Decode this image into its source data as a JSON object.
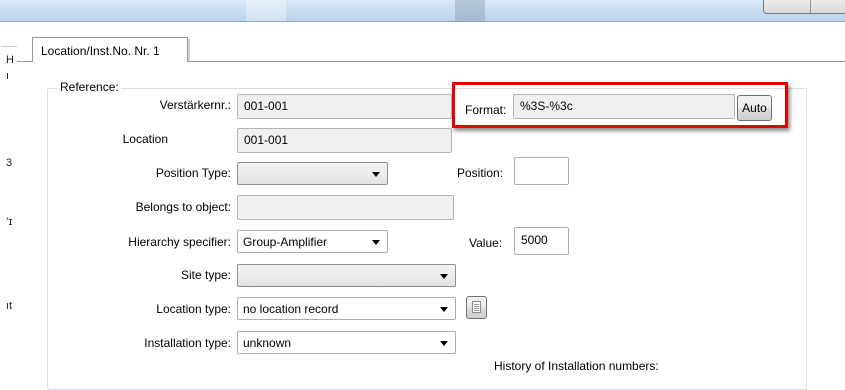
{
  "left_strip_glyphs": [
    "H",
    "ı",
    "3",
    "’ɪ",
    "ıt"
  ],
  "tab": {
    "label": "Location/Inst.No. Nr. 1"
  },
  "reference": {
    "legend": "Reference:",
    "verstarker": {
      "label": "Verstärkernr.:",
      "value": "001-001"
    },
    "location": {
      "label": "Location",
      "value": "001-001"
    },
    "position_type": {
      "label": "Position Type:",
      "value": ""
    },
    "belongs_to": {
      "label": "Belongs to object:",
      "value": ""
    },
    "hierarchy": {
      "label": "Hierarchy specifier:",
      "value": "Group-Amplifier"
    },
    "site_type": {
      "label": "Site type:",
      "value": ""
    },
    "location_type": {
      "label": "Location type:",
      "value": "no location record"
    },
    "installation_type": {
      "label": "Installation type:",
      "value": "unknown"
    },
    "format": {
      "label": "Format:",
      "value": "%3S-%3c",
      "auto_button": "Auto"
    },
    "position": {
      "label": "Position:",
      "value": ""
    },
    "value": {
      "label": "Value:",
      "value": "5000"
    },
    "history": {
      "label": "History of Installation numbers:"
    }
  },
  "icons": {
    "location_record_button": "document-icon"
  },
  "colors": {
    "highlight": "#e60000",
    "titlebar": "#c9dcf1"
  }
}
